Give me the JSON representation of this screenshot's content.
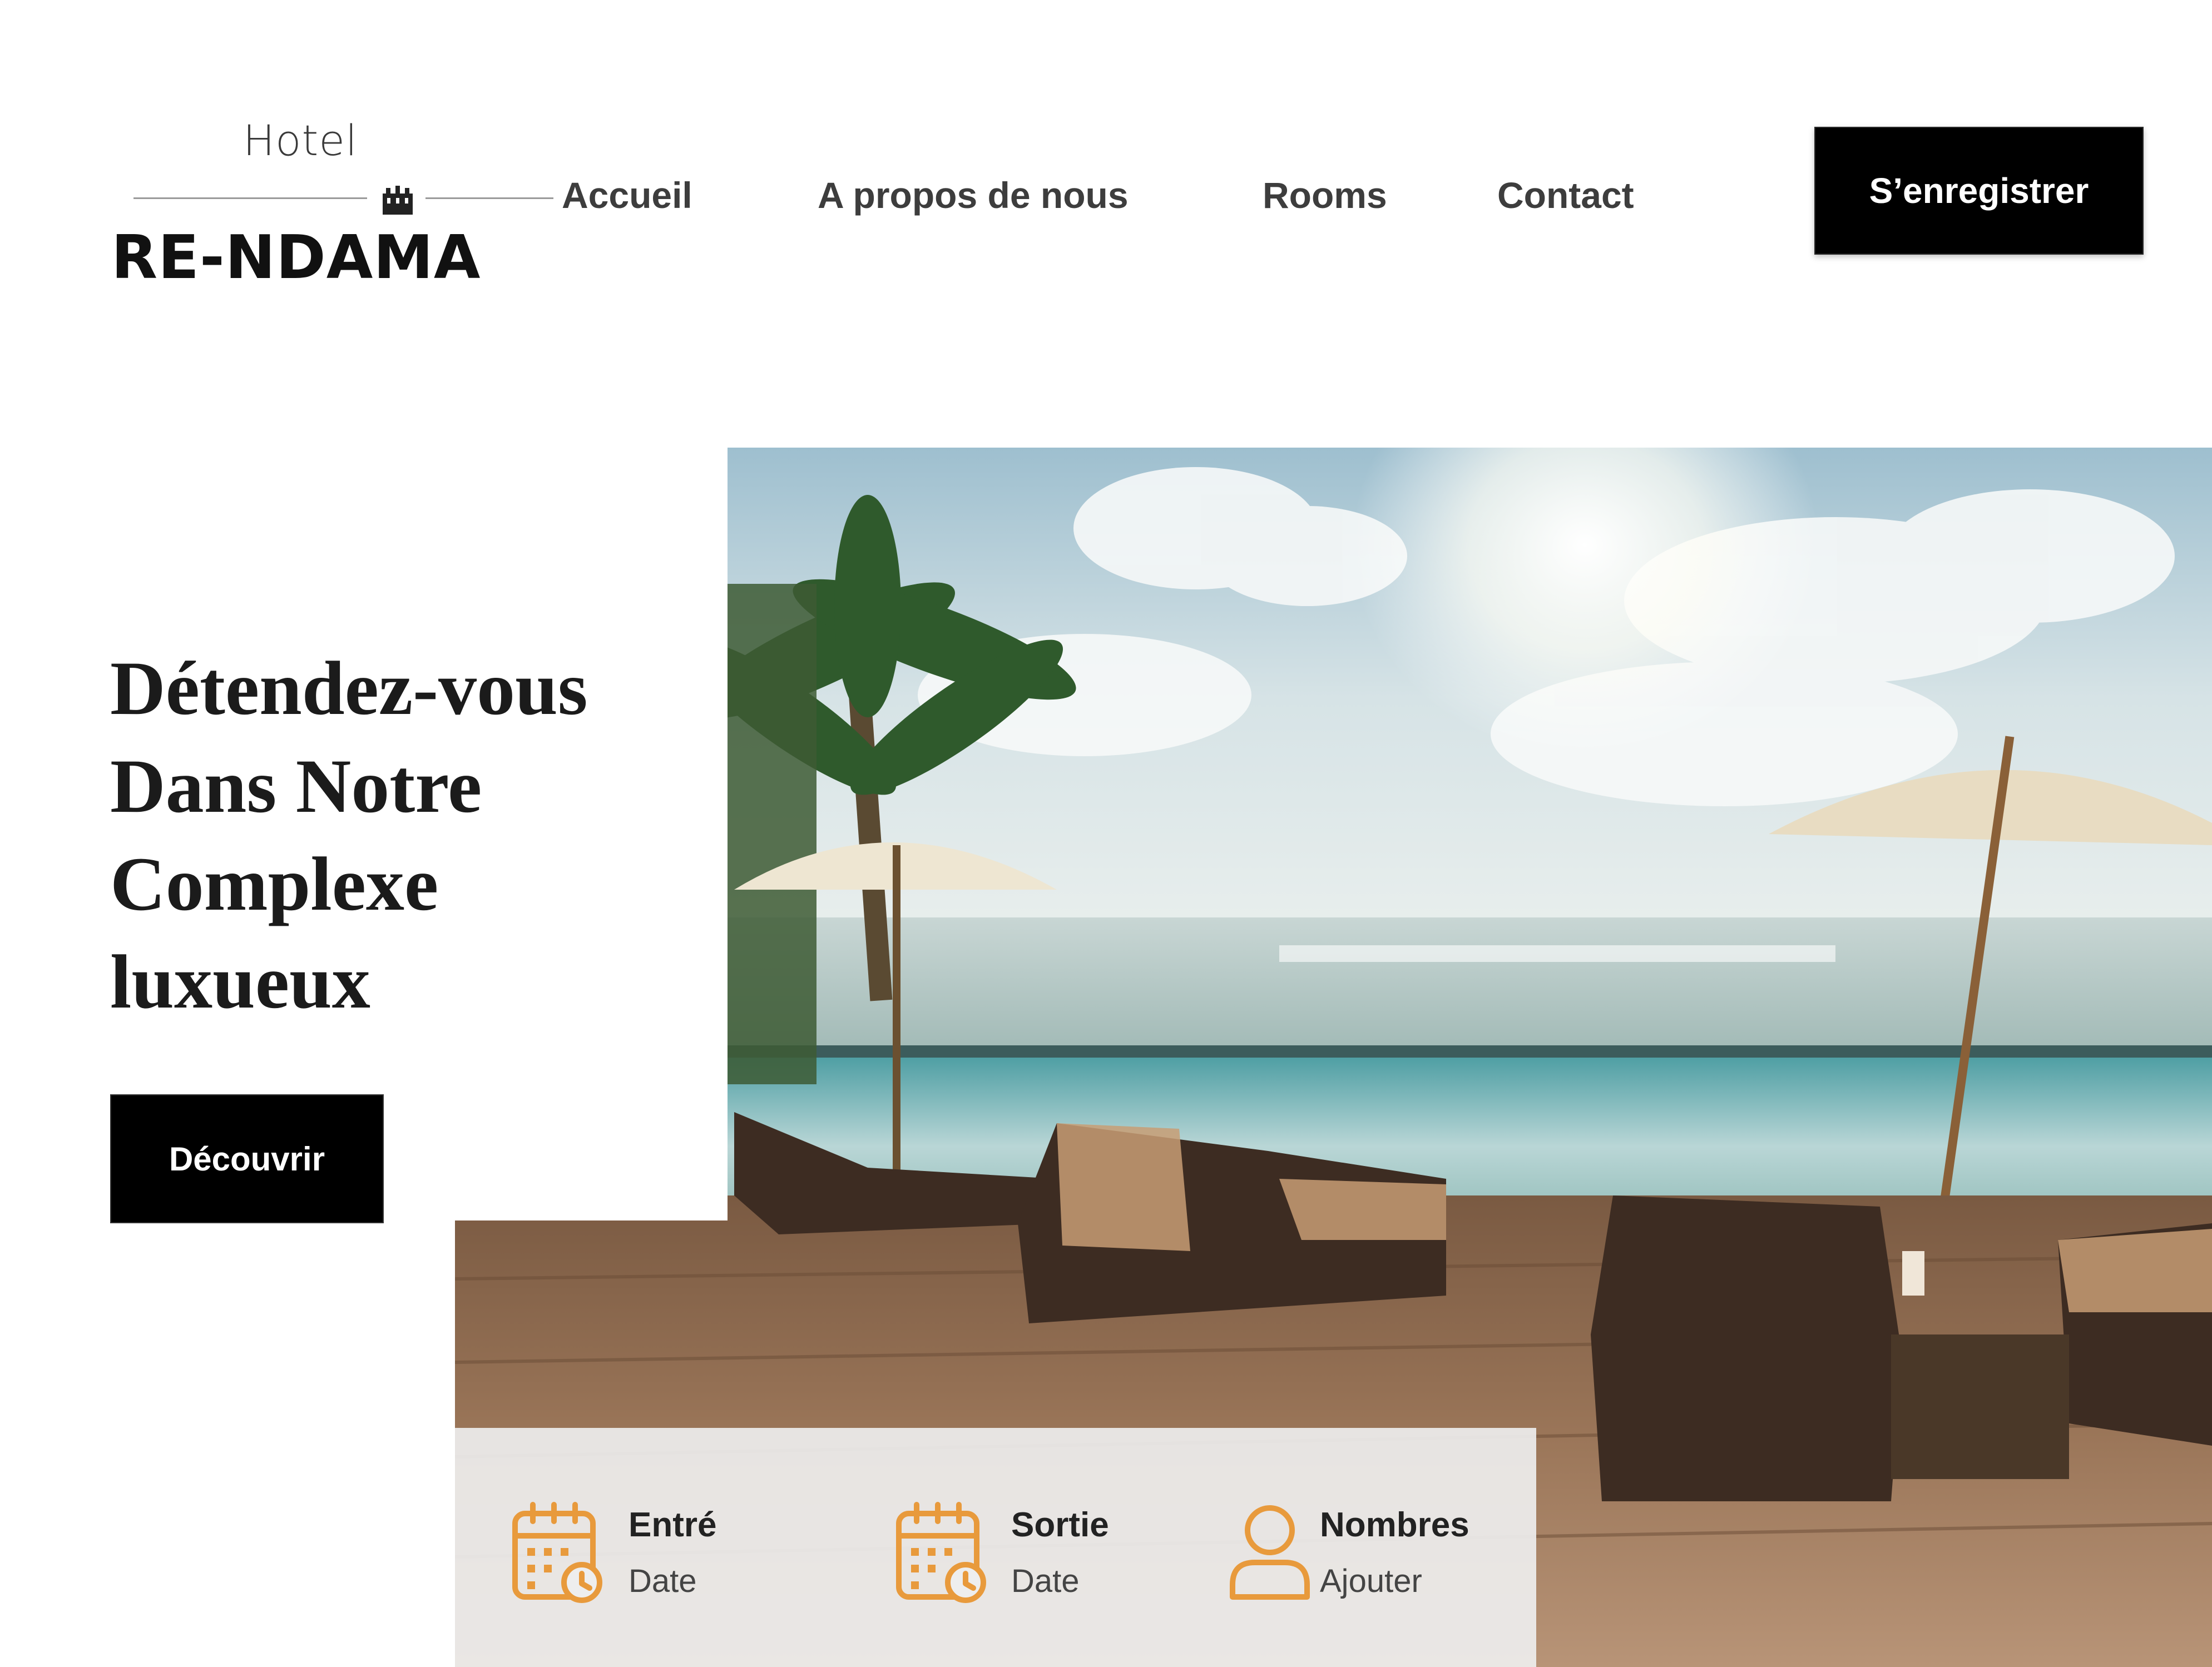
{
  "logo": {
    "hotel": "Hotel",
    "name": "RE-NDAMA"
  },
  "nav": {
    "items": [
      {
        "label": "Accueil"
      },
      {
        "label": "A propos de nous"
      },
      {
        "label": "Rooms"
      },
      {
        "label": "Contact"
      }
    ],
    "register_label": "S’enregistrer"
  },
  "hero": {
    "title_lines": [
      "Détendez-vous",
      "Dans Notre",
      "Complexe",
      "luxueux"
    ],
    "cta_label": "Découvrir"
  },
  "booking": {
    "fields": [
      {
        "label": "Entré",
        "value": "Date",
        "icon": "calendar-icon"
      },
      {
        "label": "Sortie",
        "value": "Date",
        "icon": "calendar-icon"
      },
      {
        "label": "Nombres",
        "value": "Ajouter",
        "icon": "user-icon"
      }
    ]
  },
  "colors": {
    "accent": "#E89A3C",
    "button_bg": "#000000",
    "button_text": "#FFFFFF"
  }
}
